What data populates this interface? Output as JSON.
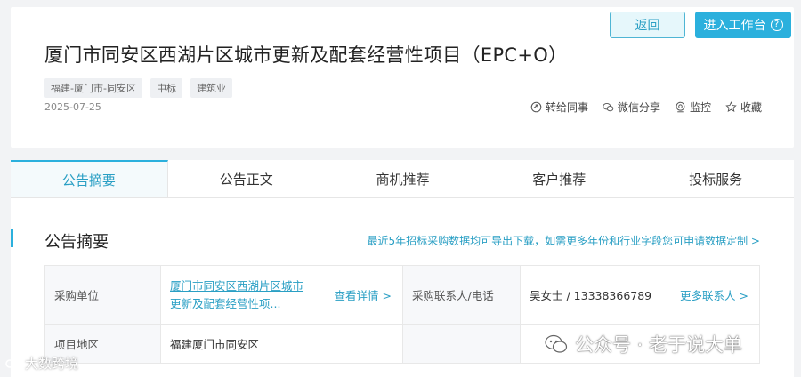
{
  "header": {
    "back_label": "返回",
    "workbench_label": "进入工作台",
    "workbench_help_glyph": "?",
    "title": "厦门市同安区西湖片区城市更新及配套经营性项目（EPC+O）",
    "tags": [
      "福建-厦门市-同安区",
      "中标",
      "建筑业"
    ],
    "date": "2025-07-25",
    "actions": [
      {
        "label": "转给同事",
        "icon": "share-forward-icon"
      },
      {
        "label": "微信分享",
        "icon": "wechat-icon"
      },
      {
        "label": "监控",
        "icon": "monitor-icon"
      },
      {
        "label": "收藏",
        "icon": "star-icon"
      }
    ]
  },
  "tabs": [
    "公告摘要",
    "公告正文",
    "商机推荐",
    "客户推荐",
    "投标服务"
  ],
  "summary": {
    "title": "公告摘要",
    "export_link": "最近5年招标采购数据均可导出下载，如需更多年份和行业字段您可申请数据定制 >",
    "rows": {
      "purchaser_label": "采购单位",
      "purchaser_name": "厦门市同安区西湖片区城市更新及配套经营性项...",
      "detail_link": "查看详情 >",
      "contact_label": "采购联系人/电话",
      "contact_value": "吴女士 / 13338366789",
      "more_contacts": "更多联系人 >",
      "region_label": "项目地区",
      "region_value": "福建厦门市同安区"
    }
  },
  "watermark": {
    "text": "公众号 · 老于说大单",
    "text2": "大数跨境"
  },
  "colors": {
    "accent": "#2bb0dd",
    "link": "#2a9fc4"
  }
}
